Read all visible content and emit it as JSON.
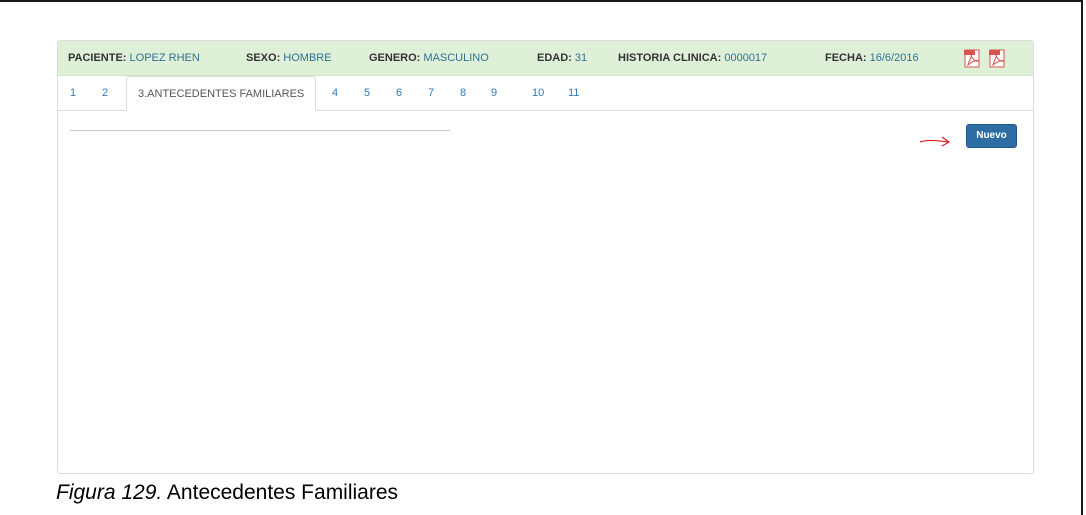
{
  "header": {
    "paciente_label": "PACIENTE:",
    "paciente_value": "LOPEZ RHEN",
    "sexo_label": "SEXO:",
    "sexo_value": "HOMBRE",
    "genero_label": "GENERO:",
    "genero_value": "MASCULINO",
    "edad_label": "EDAD:",
    "edad_value": "31",
    "historia_label": "HISTORIA CLINICA:",
    "historia_value": "0000017",
    "fecha_label": "FECHA:",
    "fecha_value": "16/6/2016",
    "icons": [
      "pdf-icon",
      "pdf-icon"
    ]
  },
  "tabs": [
    "1",
    "2",
    "3.ANTECEDENTES FAMILIARES",
    "4",
    "5",
    "6",
    "7",
    "8",
    "9",
    "10",
    "11"
  ],
  "active_tab": "3.ANTECEDENTES FAMILIARES",
  "actions": {
    "nuevo_label": "Nuevo"
  },
  "caption": {
    "figure": "Figura 129.",
    "title": "Antecedentes Familiares"
  },
  "colors": {
    "info_bar": "#dff0d8",
    "accent": "#2e6da4",
    "arrow": "#e02020",
    "link": "#337ab7"
  }
}
